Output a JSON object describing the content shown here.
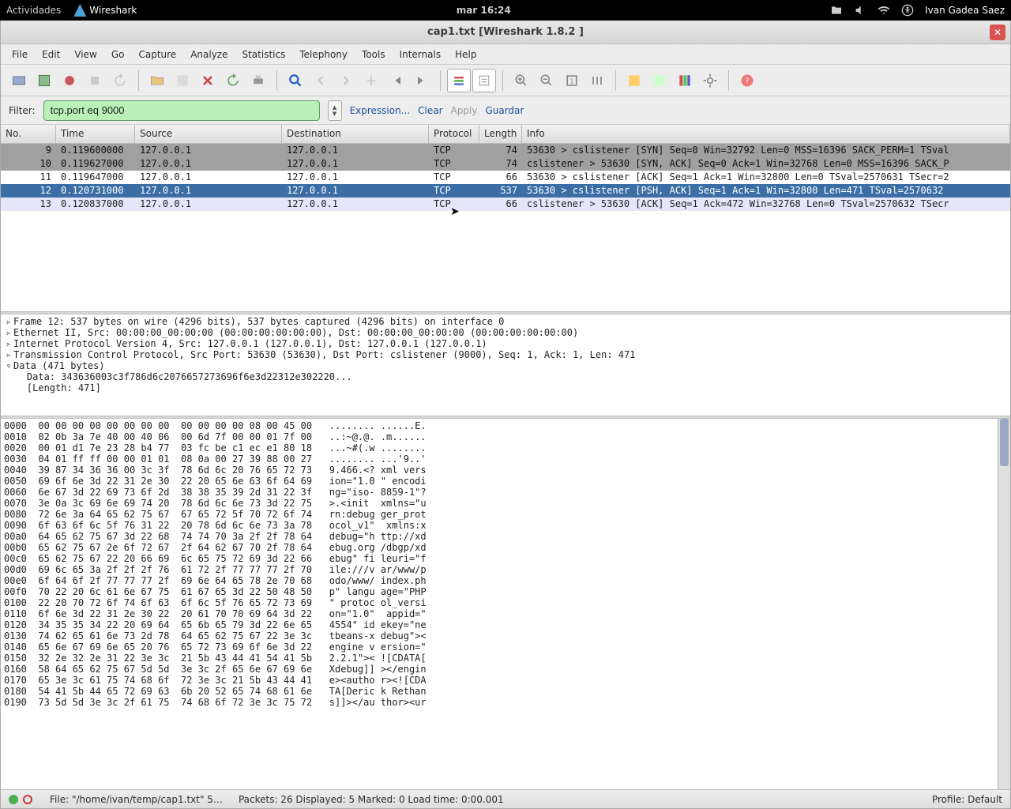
{
  "os": {
    "activities": "Actividades",
    "app": "Wireshark",
    "clock": "mar 16:24",
    "user": "Ivan Gadea Saez"
  },
  "window": {
    "title": "cap1.txt   [Wireshark 1.8.2 ]"
  },
  "menus": [
    "File",
    "Edit",
    "View",
    "Go",
    "Capture",
    "Analyze",
    "Statistics",
    "Telephony",
    "Tools",
    "Internals",
    "Help"
  ],
  "filter": {
    "label": "Filter:",
    "value": "tcp.port eq 9000",
    "expression": "Expression...",
    "clear": "Clear",
    "apply": "Apply",
    "save": "Guardar"
  },
  "columns": {
    "no": "No.",
    "time": "Time",
    "src": "Source",
    "dst": "Destination",
    "proto": "Protocol",
    "len": "Length",
    "info": "Info"
  },
  "packets": [
    {
      "cls": "syn",
      "no": "9",
      "time": "0.119600000",
      "src": "127.0.0.1",
      "dst": "127.0.0.1",
      "proto": "TCP",
      "len": "74",
      "info": "53630 > cslistener [SYN] Seq=0 Win=32792 Len=0 MSS=16396 SACK_PERM=1 TSval"
    },
    {
      "cls": "syn",
      "no": "10",
      "time": "0.119627000",
      "src": "127.0.0.1",
      "dst": "127.0.0.1",
      "proto": "TCP",
      "len": "74",
      "info": "cslistener > 53630 [SYN, ACK] Seq=0 Ack=1 Win=32768 Len=0 MSS=16396 SACK_P"
    },
    {
      "cls": "norm",
      "no": "11",
      "time": "0.119647000",
      "src": "127.0.0.1",
      "dst": "127.0.0.1",
      "proto": "TCP",
      "len": "66",
      "info": "53630 > cslistener [ACK] Seq=1 Ack=1 Win=32800 Len=0 TSval=2570631 TSecr=2"
    },
    {
      "cls": "sel",
      "no": "12",
      "time": "0.120731000",
      "src": "127.0.0.1",
      "dst": "127.0.0.1",
      "proto": "TCP",
      "len": "537",
      "info": "53630 > cslistener [PSH, ACK] Seq=1 Ack=1 Win=32800 Len=471 TSval=2570632"
    },
    {
      "cls": "ack2",
      "no": "13",
      "time": "0.120837000",
      "src": "127.0.0.1",
      "dst": "127.0.0.1",
      "proto": "TCP",
      "len": "66",
      "info": "cslistener > 53630 [ACK] Seq=1 Ack=472 Win=32768 Len=0 TSval=2570632 TSecr"
    }
  ],
  "tree": {
    "frame": "Frame 12: 537 bytes on wire (4296 bits), 537 bytes captured (4296 bits) on interface 0",
    "eth": "Ethernet II, Src: 00:00:00_00:00:00 (00:00:00:00:00:00), Dst: 00:00:00_00:00:00 (00:00:00:00:00:00)",
    "ip": "Internet Protocol Version 4, Src: 127.0.0.1 (127.0.0.1), Dst: 127.0.0.1 (127.0.0.1)",
    "tcp": "Transmission Control Protocol, Src Port: 53630 (53630), Dst Port: cslistener (9000), Seq: 1, Ack: 1, Len: 471",
    "data": "Data (471 bytes)",
    "data_hex": "    Data: 343636003c3f786d6c2076657273696f6e3d22312e302220...",
    "data_len": "    [Length: 471]"
  },
  "hex": [
    "0000  00 00 00 00 00 00 00 00  00 00 00 00 08 00 45 00   ........ ......E.",
    "0010  02 0b 3a 7e 40 00 40 06  00 6d 7f 00 00 01 7f 00   ..:~@.@. .m......",
    "0020  00 01 d1 7e 23 28 b4 77  03 fc be c1 ec e1 80 18   ...~#(.w ........",
    "0030  04 01 ff ff 00 00 01 01  08 0a 00 27 39 88 00 27   ........ ...'9..'",
    "0040  39 87 34 36 36 00 3c 3f  78 6d 6c 20 76 65 72 73   9.466.<? xml vers",
    "0050  69 6f 6e 3d 22 31 2e 30  22 20 65 6e 63 6f 64 69   ion=\"1.0 \" encodi",
    "0060  6e 67 3d 22 69 73 6f 2d  38 38 35 39 2d 31 22 3f   ng=\"iso- 8859-1\"?",
    "0070  3e 0a 3c 69 6e 69 74 20  78 6d 6c 6e 73 3d 22 75   >.<init  xmlns=\"u",
    "0080  72 6e 3a 64 65 62 75 67  67 65 72 5f 70 72 6f 74   rn:debug ger_prot",
    "0090  6f 63 6f 6c 5f 76 31 22  20 78 6d 6c 6e 73 3a 78   ocol_v1\"  xmlns:x",
    "00a0  64 65 62 75 67 3d 22 68  74 74 70 3a 2f 2f 78 64   debug=\"h ttp://xd",
    "00b0  65 62 75 67 2e 6f 72 67  2f 64 62 67 70 2f 78 64   ebug.org /dbgp/xd",
    "00c0  65 62 75 67 22 20 66 69  6c 65 75 72 69 3d 22 66   ebug\" fi leuri=\"f",
    "00d0  69 6c 65 3a 2f 2f 2f 76  61 72 2f 77 77 77 2f 70   ile:///v ar/www/p",
    "00e0  6f 64 6f 2f 77 77 77 2f  69 6e 64 65 78 2e 70 68   odo/www/ index.ph",
    "00f0  70 22 20 6c 61 6e 67 75  61 67 65 3d 22 50 48 50   p\" langu age=\"PHP",
    "0100  22 20 70 72 6f 74 6f 63  6f 6c 5f 76 65 72 73 69   \" protoc ol_versi",
    "0110  6f 6e 3d 22 31 2e 30 22  20 61 70 70 69 64 3d 22   on=\"1.0\"  appid=\"",
    "0120  34 35 35 34 22 20 69 64  65 6b 65 79 3d 22 6e 65   4554\" id ekey=\"ne",
    "0130  74 62 65 61 6e 73 2d 78  64 65 62 75 67 22 3e 3c   tbeans-x debug\"><",
    "0140  65 6e 67 69 6e 65 20 76  65 72 73 69 6f 6e 3d 22   engine v ersion=\"",
    "0150  32 2e 32 2e 31 22 3e 3c  21 5b 43 44 41 54 41 5b   2.2.1\">< ![CDATA[",
    "0160  58 64 65 62 75 67 5d 5d  3e 3c 2f 65 6e 67 69 6e   Xdebug]] ></engin",
    "0170  65 3e 3c 61 75 74 68 6f  72 3e 3c 21 5b 43 44 41   e><autho r><![CDA",
    "0180  54 41 5b 44 65 72 69 63  6b 20 52 65 74 68 61 6e   TA[Deric k Rethan",
    "0190  73 5d 5d 3e 3c 2f 61 75  74 68 6f 72 3e 3c 75 72   s]]></au thor><ur"
  ],
  "status": {
    "file": "File: \"/home/ivan/temp/cap1.txt\" 5…",
    "packets": "Packets: 26 Displayed: 5 Marked: 0 Load time: 0:00.001",
    "profile": "Profile: Default"
  }
}
